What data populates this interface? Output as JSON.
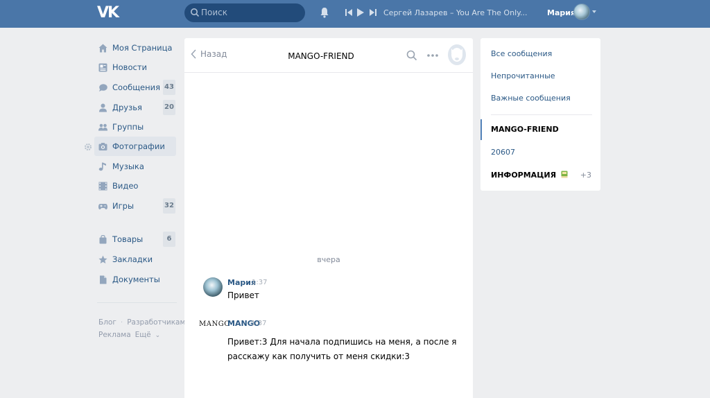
{
  "header": {
    "logo_text": "VK",
    "search_placeholder": "Поиск",
    "now_playing": "Сергей Лазарев – You Are The Only...",
    "user_name": "Мария"
  },
  "sidebar": {
    "items": [
      {
        "label": "Моя Страница",
        "icon": "home-icon",
        "badge": ""
      },
      {
        "label": "Новости",
        "icon": "news-icon",
        "badge": ""
      },
      {
        "label": "Сообщения",
        "icon": "messages-icon",
        "badge": "43"
      },
      {
        "label": "Друзья",
        "icon": "friends-icon",
        "badge": "20"
      },
      {
        "label": "Группы",
        "icon": "groups-icon",
        "badge": ""
      },
      {
        "label": "Фотографии",
        "icon": "camera-icon",
        "badge": ""
      },
      {
        "label": "Музыка",
        "icon": "music-icon",
        "badge": ""
      },
      {
        "label": "Видео",
        "icon": "video-icon",
        "badge": ""
      },
      {
        "label": "Игры",
        "icon": "gamepad-icon",
        "badge": "32"
      },
      {
        "label": "Товары",
        "icon": "bag-icon",
        "badge": "6"
      },
      {
        "label": "Закладки",
        "icon": "star-icon",
        "badge": ""
      },
      {
        "label": "Документы",
        "icon": "document-icon",
        "badge": ""
      }
    ],
    "footer": {
      "blog": "Блог",
      "developers": "Разработчикам",
      "ads": "Реклама",
      "more": "Ещё"
    }
  },
  "chat": {
    "back_label": "Назад",
    "title": "MANGO-FRIEND",
    "day_separator": "вчера",
    "messages": [
      {
        "author": "Мария",
        "time": "1:37",
        "text": "Привет"
      },
      {
        "author": "MANGO",
        "logo_text": "MANGO",
        "time": "1:37",
        "text": "Привет:3 Для начала подпишись на меня, а после я\nрасскажу как получить от меня скидки:3"
      }
    ]
  },
  "right_panel": {
    "all_messages": "Все сообщения",
    "unread": "Непрочитанные",
    "important": "Важные сообщения",
    "conversations": [
      {
        "label": "MANGO-FRIEND",
        "count": ""
      },
      {
        "label": "20607",
        "count": ""
      },
      {
        "label": "ИНФОРМАЦИЯ",
        "count": "+3"
      }
    ]
  },
  "colors": {
    "header_bg": "#4a76a8",
    "link": "#2a5885",
    "page_bg": "#edeef0"
  }
}
